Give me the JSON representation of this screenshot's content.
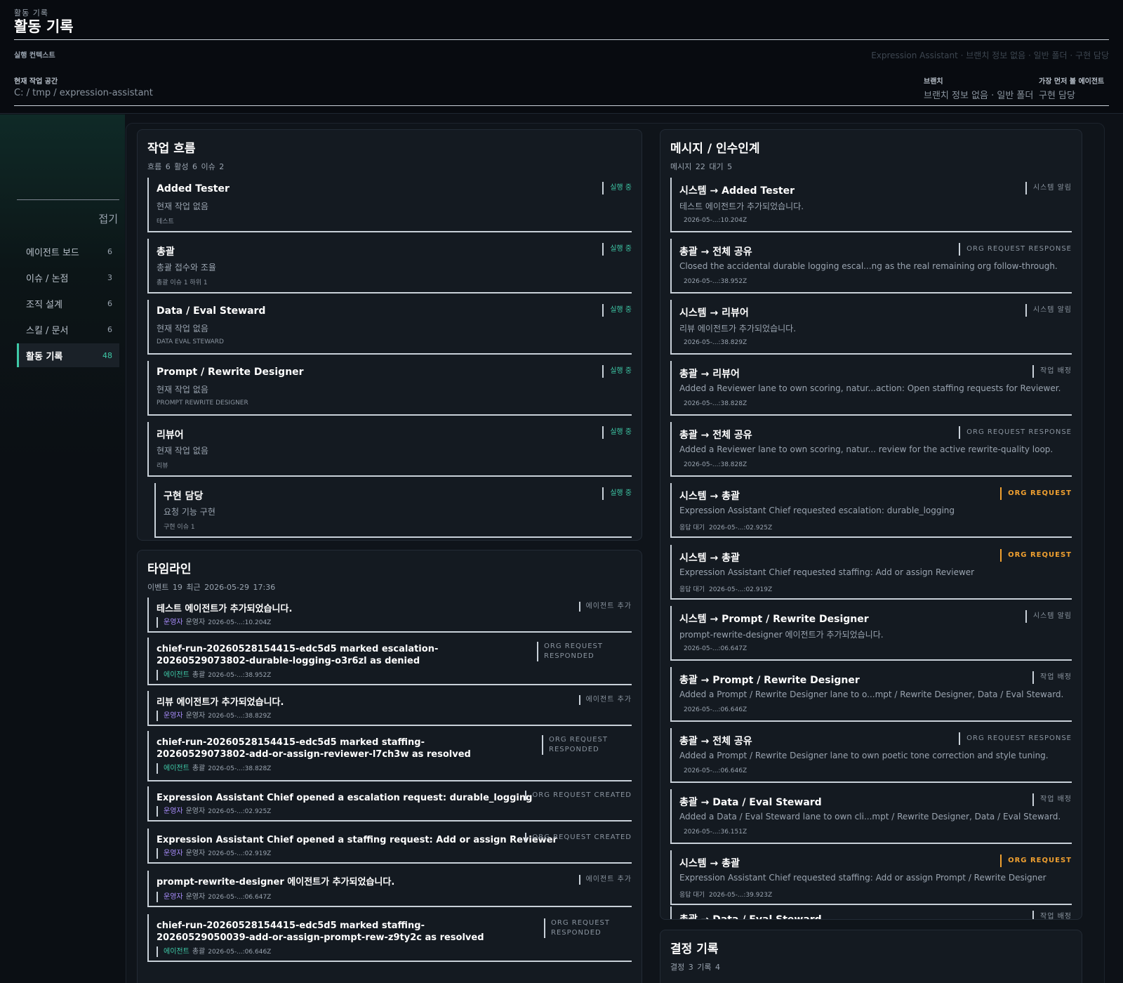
{
  "header": {
    "eyebrow": "활동 기록",
    "title": "활동 기록",
    "context_label": "실행 컨텍스트",
    "context_summary": "Expression Assistant · 브랜치 정보 없음 · 일반 폴더 · 구현 담당",
    "workspace_label": "현재 작업 공간",
    "workspace_value": "C: / tmp / expression-assistant",
    "branch_label": "브랜치",
    "branch_value": "브랜치 정보 없음 · 일반 폴더",
    "first_agent_label": "가장 먼저 볼 에이전트",
    "first_agent_value": "구현 담당"
  },
  "sidebar": {
    "collapse_label": "접기",
    "items": [
      {
        "label": "에이전트 보드",
        "count": "6"
      },
      {
        "label": "이슈 / 논점",
        "count": "3"
      },
      {
        "label": "조직 설계",
        "count": "6"
      },
      {
        "label": "스킬 / 문서",
        "count": "6"
      },
      {
        "label": "활동 기록",
        "count": "48"
      }
    ]
  },
  "workflow": {
    "title": "작업 흐름",
    "meta": "흐름 6   활성 6   이슈 2",
    "lanes": [
      {
        "name": "Added Tester",
        "task": "현재 작업 없음",
        "foot": "테스트",
        "status": "실행 중"
      },
      {
        "name": "총괄",
        "task": "총괄 접수와 조율",
        "foot": "총괄  이슈 1  하위 1",
        "status": "실행 중"
      },
      {
        "name": "Data / Eval Steward",
        "task": "현재 작업 없음",
        "foot": "DATA EVAL STEWARD",
        "status": "실행 중"
      },
      {
        "name": "Prompt / Rewrite Designer",
        "task": "현재 작업 없음",
        "foot": "PROMPT REWRITE DESIGNER",
        "status": "실행 중"
      },
      {
        "name": "리뷰어",
        "task": "현재 작업 없음",
        "foot": "리뷰",
        "status": "실행 중"
      },
      {
        "name": "구현 담당",
        "task": "요청 기능 구현",
        "foot": "구현  이슈 1",
        "status": "실행 중"
      }
    ]
  },
  "timeline": {
    "title": "타임라인",
    "meta": "이벤트 19   최근 2026-05-29 17:36",
    "events": [
      {
        "title": "테스트 에이전트가 추가되었습니다.",
        "actor_type": "운영자",
        "actor": "운영자",
        "time": "2026-05-...:10.204Z",
        "kind": "에이전트 추가"
      },
      {
        "title": "chief-run-20260528154415-edc5d5 marked escalation-20260529073802-durable-logging-o3r6zl as denied",
        "actor_type": "에이전트",
        "actor": "총괄",
        "time": "2026-05-...:38.952Z",
        "kind": "ORG REQUEST RESPONDED"
      },
      {
        "title": "리뷰 에이전트가 추가되었습니다.",
        "actor_type": "운영자",
        "actor": "운영자",
        "time": "2026-05-...:38.829Z",
        "kind": "에이전트 추가"
      },
      {
        "title": "chief-run-20260528154415-edc5d5 marked staffing-20260529073802-add-or-assign-reviewer-l7ch3w as resolved",
        "actor_type": "에이전트",
        "actor": "총괄",
        "time": "2026-05-...:38.828Z",
        "kind": "ORG REQUEST RESPONDED"
      },
      {
        "title": "Expression Assistant Chief opened a escalation request: durable_logging",
        "actor_type": "운영자",
        "actor": "운영자",
        "time": "2026-05-...:02.925Z",
        "kind": "ORG REQUEST CREATED"
      },
      {
        "title": "Expression Assistant Chief opened a staffing request: Add or assign Reviewer",
        "actor_type": "운영자",
        "actor": "운영자",
        "time": "2026-05-...:02.919Z",
        "kind": "ORG REQUEST CREATED"
      },
      {
        "title": "prompt-rewrite-designer 에이전트가 추가되었습니다.",
        "actor_type": "운영자",
        "actor": "운영자",
        "time": "2026-05-...:06.647Z",
        "kind": "에이전트 추가"
      },
      {
        "title": "chief-run-20260528154415-edc5d5 marked staffing-20260529050039-add-or-assign-prompt-rew-z9ty2c as resolved",
        "actor_type": "에이전트",
        "actor": "총괄",
        "time": "2026-05-...:06.646Z",
        "kind": "ORG REQUEST RESPONDED"
      }
    ]
  },
  "messages": {
    "title": "메시지 / 인수인계",
    "meta": "메시지 22   대기 5",
    "items": [
      {
        "route": "시스템 → Added Tester",
        "body": "테스트 에이전트가 추가되었습니다.",
        "wait": "",
        "time": "2026-05-...:10.204Z",
        "kind": "시스템 알림"
      },
      {
        "route": "총괄 → 전체 공유",
        "body": "Closed the accidental durable logging escal...ng as the real remaining org follow-through.",
        "wait": "",
        "time": "2026-05-...:38.952Z",
        "kind": "ORG REQUEST RESPONSE"
      },
      {
        "route": "시스템 → 리뷰어",
        "body": "리뷰 에이전트가 추가되었습니다.",
        "wait": "",
        "time": "2026-05-...:38.829Z",
        "kind": "시스템 알림"
      },
      {
        "route": "총괄 → 리뷰어",
        "body": "Added a Reviewer lane to own scoring, natur...action: Open staffing requests for Reviewer.",
        "wait": "",
        "time": "2026-05-...:38.828Z",
        "kind": "작업 배정"
      },
      {
        "route": "총괄 → 전체 공유",
        "body": "Added a Reviewer lane to own scoring, natur... review for the active rewrite-quality loop.",
        "wait": "",
        "time": "2026-05-...:38.828Z",
        "kind": "ORG REQUEST RESPONSE"
      },
      {
        "route": "시스템 → 총괄",
        "body": "Expression Assistant Chief requested escalation: durable_logging",
        "wait": "응답 대기",
        "time": "2026-05-...:02.925Z",
        "kind": "ORG REQUEST"
      },
      {
        "route": "시스템 → 총괄",
        "body": "Expression Assistant Chief requested staffing: Add or assign Reviewer",
        "wait": "응답 대기",
        "time": "2026-05-...:02.919Z",
        "kind": "ORG REQUEST"
      },
      {
        "route": "시스템 → Prompt / Rewrite Designer",
        "body": "prompt-rewrite-designer 에이전트가 추가되었습니다.",
        "wait": "",
        "time": "2026-05-...:06.647Z",
        "kind": "시스템 알림"
      },
      {
        "route": "총괄 → Prompt / Rewrite Designer",
        "body": "Added a Prompt / Rewrite Designer lane to o...mpt / Rewrite Designer, Data / Eval Steward.",
        "wait": "",
        "time": "2026-05-...:06.646Z",
        "kind": "작업 배정"
      },
      {
        "route": "총괄 → 전체 공유",
        "body": "Added a Prompt / Rewrite Designer lane to own poetic tone correction and style tuning.",
        "wait": "",
        "time": "2026-05-...:06.646Z",
        "kind": "ORG REQUEST RESPONSE"
      },
      {
        "route": "총괄 → Data / Eval Steward",
        "body": "Added a Data / Eval Steward lane to own cli...mpt / Rewrite Designer, Data / Eval Steward.",
        "wait": "",
        "time": "2026-05-...:36.151Z",
        "kind": "작업 배정"
      },
      {
        "route": "시스템 → 총괄",
        "body": "Expression Assistant Chief requested staffing: Add or assign Prompt / Rewrite Designer",
        "wait": "응답 대기",
        "time": "2026-05-...:39.923Z",
        "kind": "ORG REQUEST"
      },
      {
        "route": "총괄 → Data / Eval Steward",
        "body": "",
        "wait": "",
        "time": "",
        "kind": "작업 배정"
      }
    ]
  },
  "decisions": {
    "title": "결정 기록",
    "meta": "결정 3   기록 4"
  }
}
